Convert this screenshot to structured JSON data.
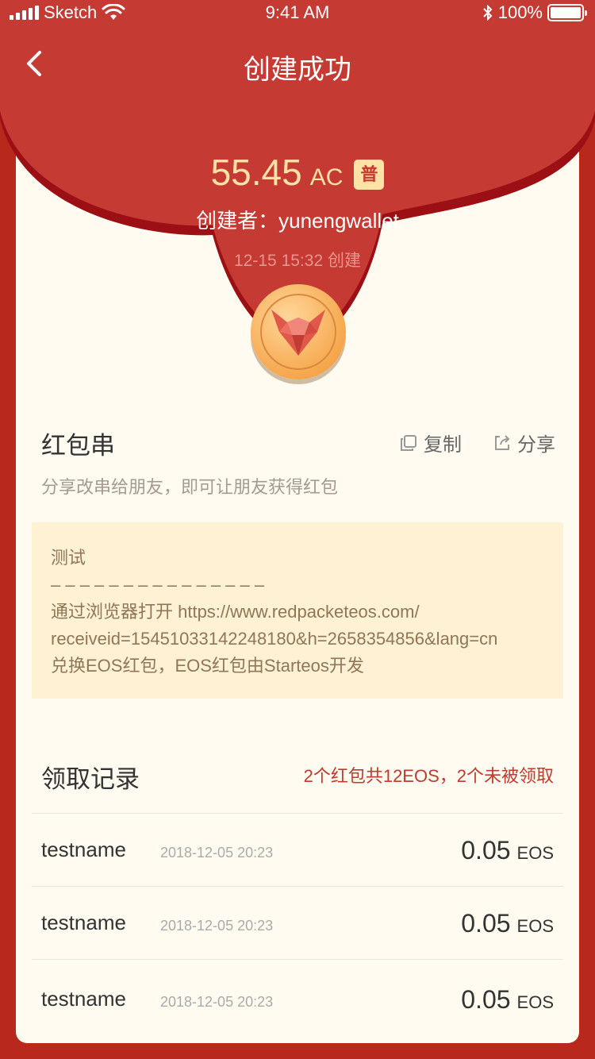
{
  "status_bar": {
    "carrier": "Sketch",
    "time": "9:41 AM",
    "battery": "100%"
  },
  "nav": {
    "title": "创建成功"
  },
  "packet": {
    "amount": "55.45",
    "unit": "AC",
    "type_badge": "普",
    "creator_label": "创建者：",
    "creator": "yunengwallet",
    "created_time": "12-15 15:32 创建"
  },
  "string_section": {
    "title": "红包串",
    "copy_label": "复制",
    "share_label": "分享",
    "hint": "分享改串给朋友，即可让朋友获得红包",
    "lines": [
      "测试",
      "– – – – – – – – – – – – – – –",
      "通过浏览器打开 https://www.redpacketeos.com/",
      "receiveid=15451033142248180&h=2658354856&lang=cn",
      "兑换EOS红包，EOS红包由Starteos开发"
    ]
  },
  "records": {
    "title": "领取记录",
    "summary": "2个红包共12EOS，2个未被领取",
    "rows": [
      {
        "name": "testname",
        "time": "2018-12-05 20:23",
        "amount": "0.05",
        "unit": "EOS"
      },
      {
        "name": "testname",
        "time": "2018-12-05 20:23",
        "amount": "0.05",
        "unit": "EOS"
      },
      {
        "name": "testname",
        "time": "2018-12-05 20:23",
        "amount": "0.05",
        "unit": "EOS"
      }
    ]
  },
  "colors": {
    "background": "#b8281c",
    "header_red": "#c63a34",
    "card": "#fffbf0",
    "accent_gold": "#ffe2a6"
  }
}
